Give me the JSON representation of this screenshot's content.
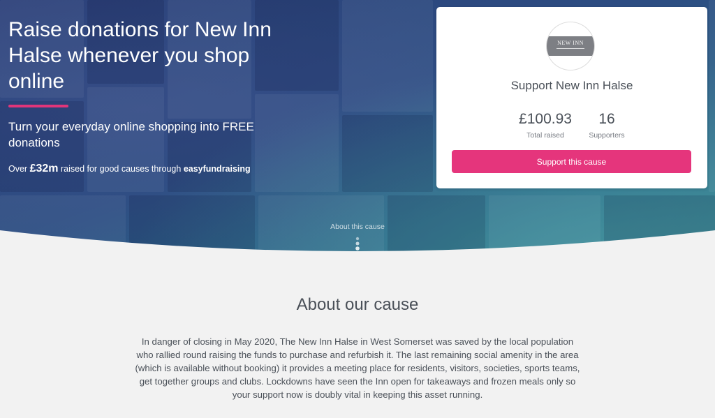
{
  "hero": {
    "title": "Raise donations for New Inn Halse whenever you shop online",
    "subtitle": "Turn your everyday online shopping into FREE donations",
    "stat_prefix": "Over",
    "stat_amount": "£32m",
    "stat_middle": "raised for good causes through",
    "stat_brand": "easyfundraising",
    "accent_color": "#e0357a"
  },
  "card": {
    "logo_text": "NEW INN",
    "title": "Support New Inn Halse",
    "total_raised_value": "£100.93",
    "total_raised_label": "Total raised",
    "supporters_value": "16",
    "supporters_label": "Supporters",
    "button_label": "Support this cause",
    "button_color": "#e5357c"
  },
  "scroll": {
    "label": "About this cause",
    "icon": "chevron-down-icon"
  },
  "about": {
    "title": "About our cause",
    "body": "In danger of closing in May 2020, The New Inn Halse in West Somerset was saved by the local population who rallied round raising the funds to purchase and refurbish it. The last remaining social amenity in the area (which is available without booking) it provides a meeting place for residents, visitors, societies, sports teams, get together groups and clubs. Lockdowns have seen the Inn open for takeaways and frozen meals only so your support now is doubly vital in keeping this asset running."
  }
}
